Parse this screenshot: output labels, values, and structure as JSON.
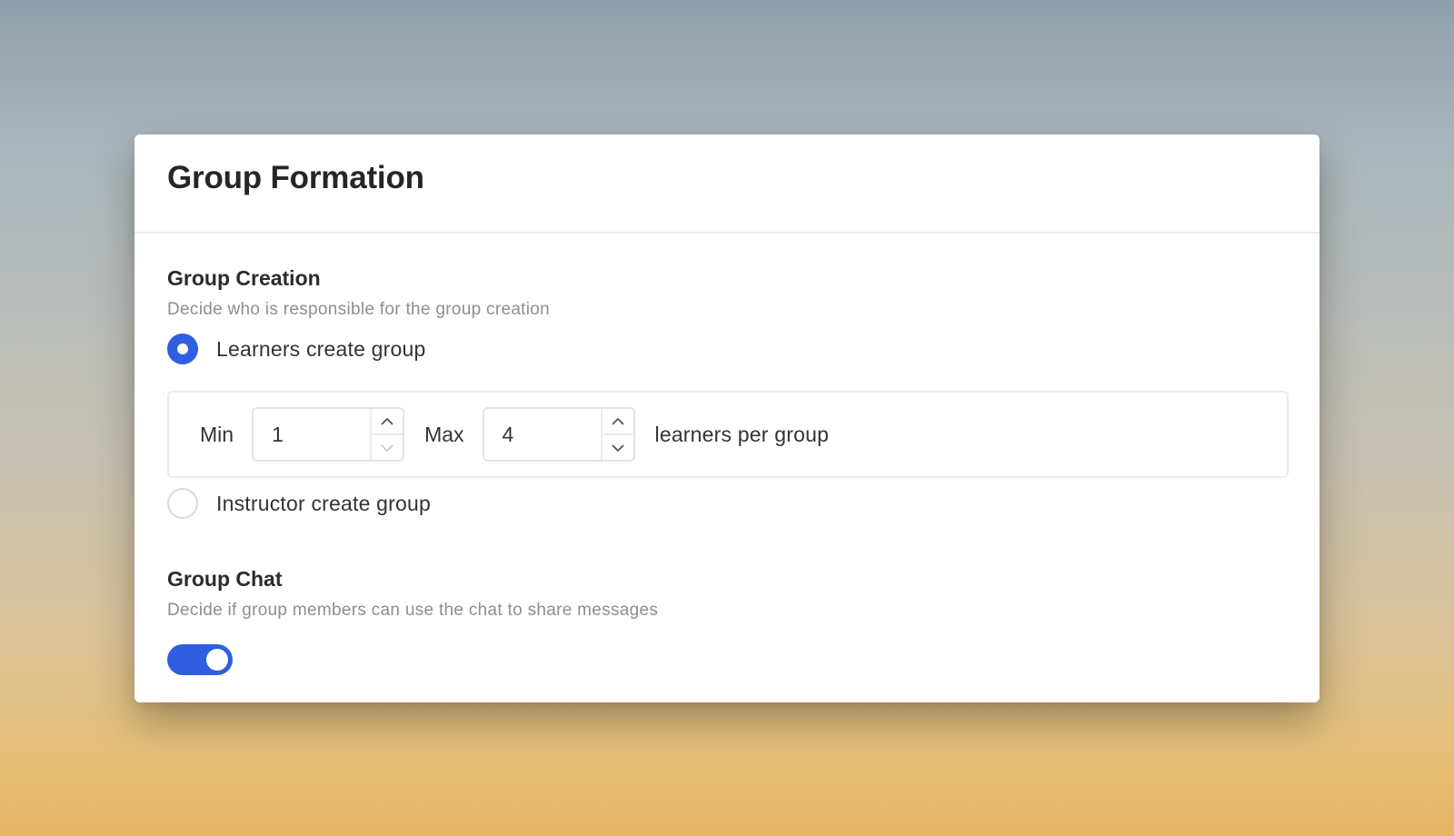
{
  "dialog": {
    "title": "Group Formation"
  },
  "group_creation": {
    "title": "Group Creation",
    "description": "Decide who is responsible for the group creation",
    "options": [
      {
        "label": "Learners create group",
        "selected": true
      },
      {
        "label": "Instructor create group",
        "selected": false
      }
    ],
    "range": {
      "min_label": "Min",
      "min_value": "1",
      "max_label": "Max",
      "max_value": "4",
      "suffix": "learners per group"
    }
  },
  "group_chat": {
    "title": "Group Chat",
    "description": "Decide if group members can use the chat to share messages",
    "enabled": true
  },
  "colors": {
    "accent": "#2f5fe0",
    "background_top": "#8fa0ad",
    "background_bottom": "#e4b565"
  }
}
